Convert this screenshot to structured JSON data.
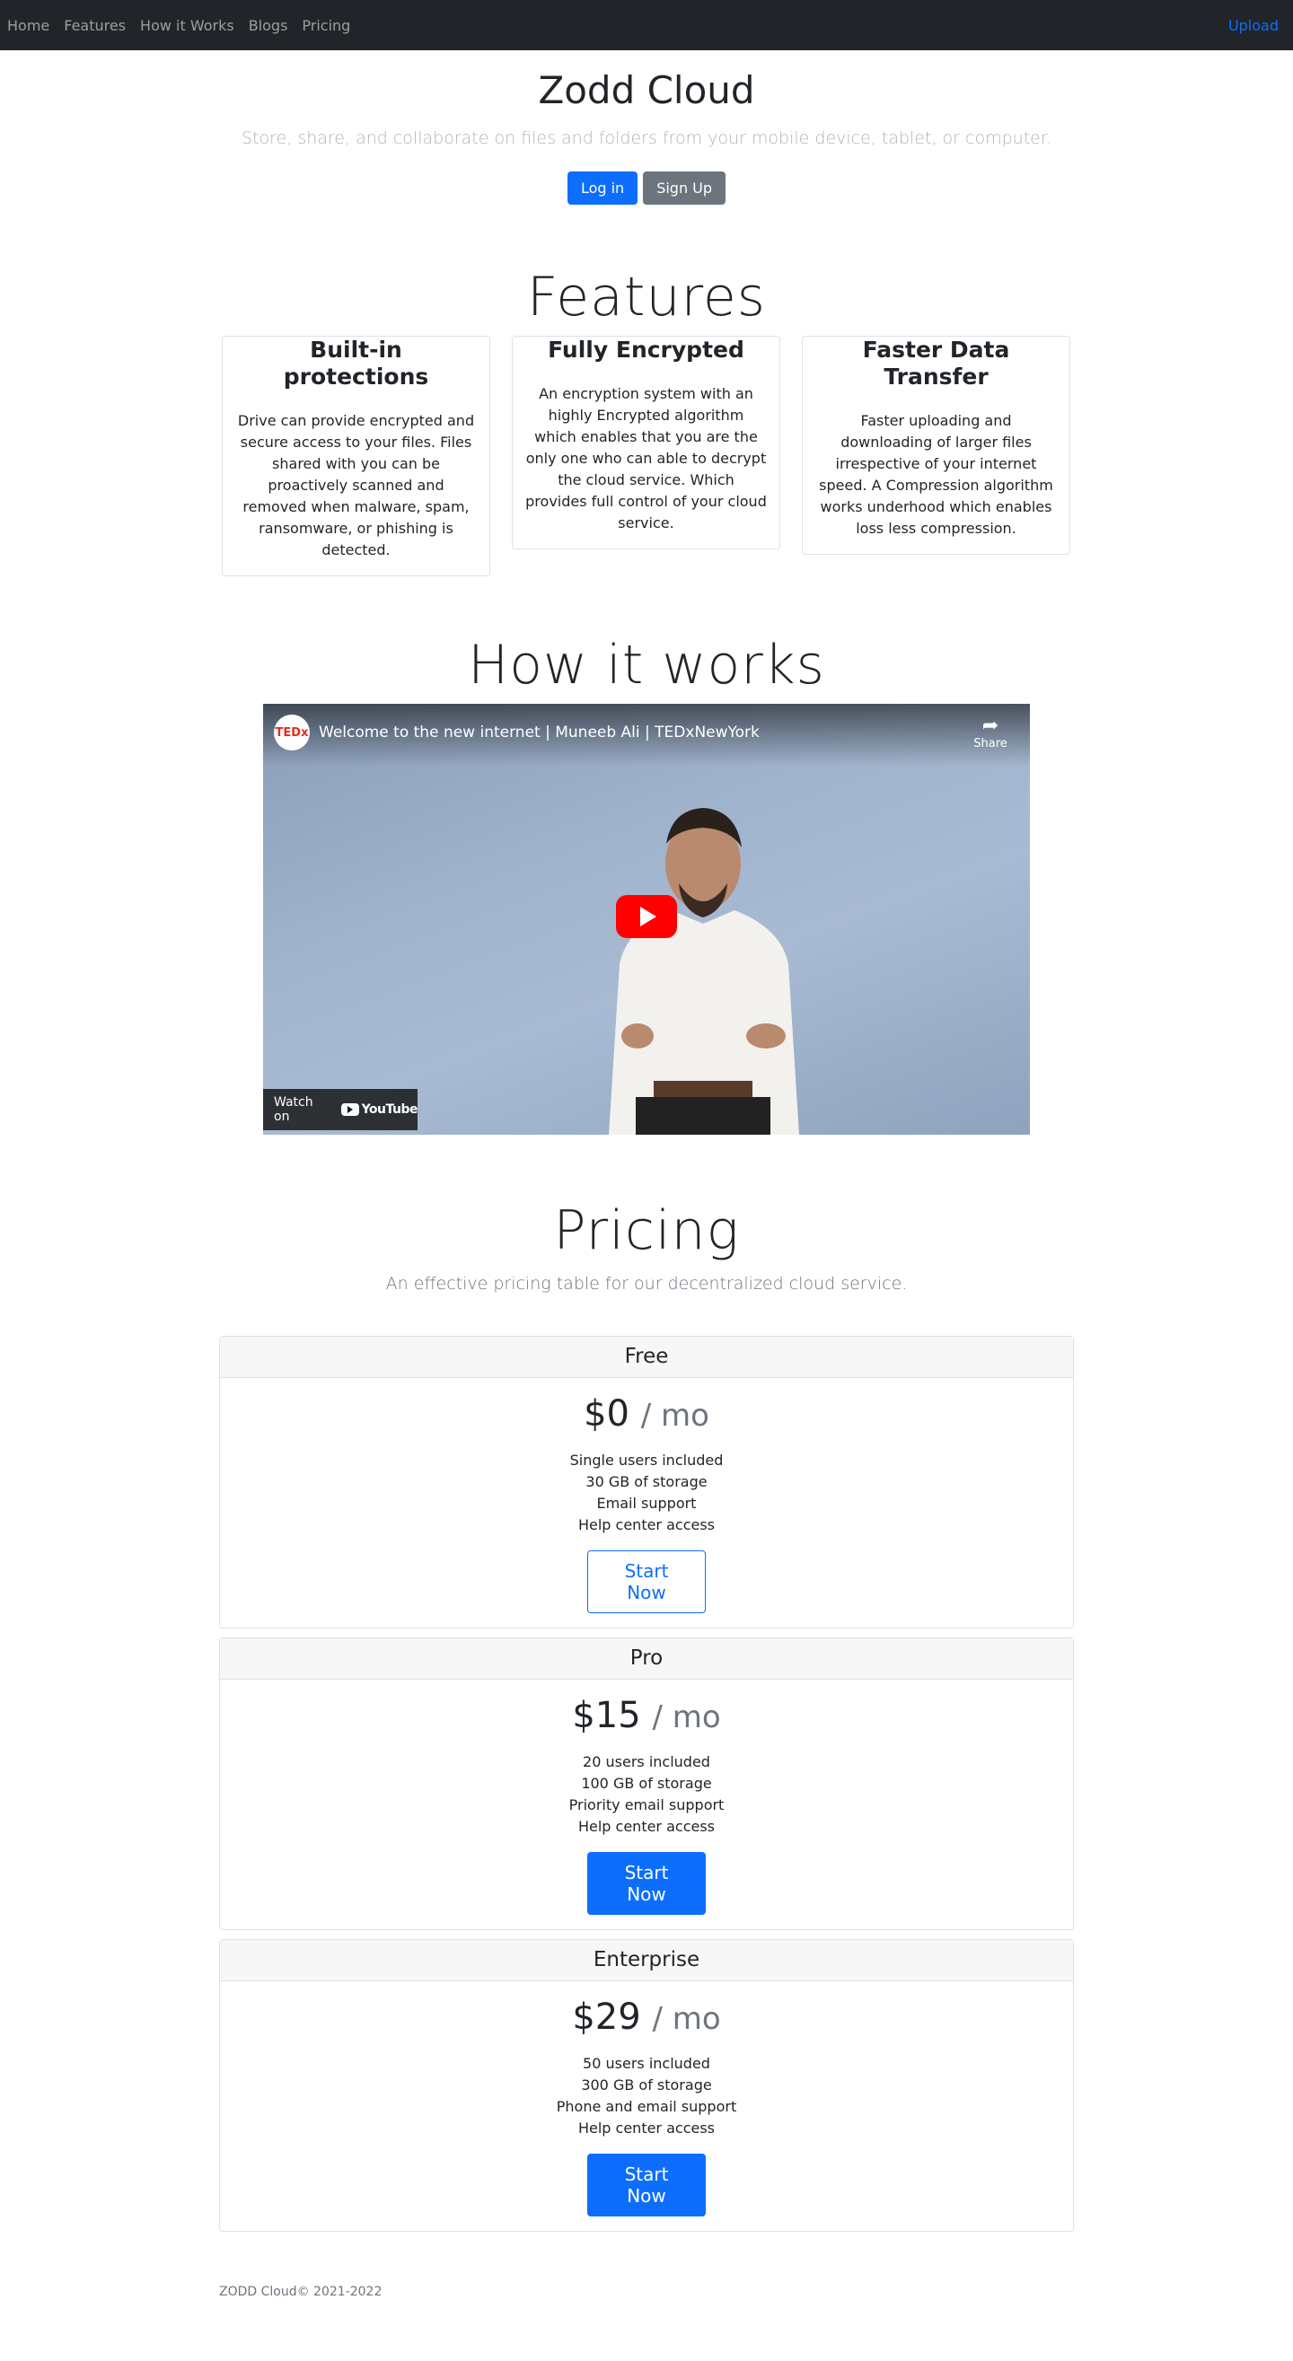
{
  "nav": {
    "links": [
      "Home",
      "Features",
      "How it Works",
      "Blogs",
      "Pricing"
    ],
    "upload": "Upload"
  },
  "hero": {
    "title": "Zodd Cloud",
    "subtitle": "Store, share, and collaborate on files and folders from your mobile device, tablet, or computer.",
    "login": "Log in",
    "signup": "Sign Up"
  },
  "features": {
    "title": "Features",
    "cards": [
      {
        "title": "Built-in protections",
        "text": "Drive can provide encrypted and secure access to your files. Files shared with you can be proactively scanned and removed when malware, spam, ransomware, or phishing is detected."
      },
      {
        "title": "Fully Encrypted",
        "text": "An encryption system with an highly Encrypted algorithm which enables that you are the only one who can able to decrypt the cloud service. Which provides full control of your cloud service."
      },
      {
        "title": "Faster Data Transfer",
        "text": "Faster uploading and downloading of larger files irrespective of your internet speed. A Compression algorithm works underhood which enables loss less compression."
      }
    ]
  },
  "how": {
    "title": "How it works",
    "video_title": "Welcome to the new internet | Muneeb Ali | TEDxNewYork",
    "ted_logo": "TEDx",
    "share": "Share",
    "watch_on": "Watch on",
    "youtube": "YouTube"
  },
  "pricing": {
    "title": "Pricing",
    "subtitle": "An effective pricing table for our decentralized cloud service.",
    "per": "/ mo",
    "plans": [
      {
        "name": "Free",
        "price": "$0",
        "features": [
          "Single users included",
          "30 GB of storage",
          "Email support",
          "Help center access"
        ],
        "button": "Start Now"
      },
      {
        "name": "Pro",
        "price": "$15",
        "features": [
          "20 users included",
          "100 GB of storage",
          "Priority email support",
          "Help center access"
        ],
        "button": "Start Now"
      },
      {
        "name": "Enterprise",
        "price": "$29",
        "features": [
          "50 users included",
          "300 GB of storage",
          "Phone and email support",
          "Help center access"
        ],
        "button": "Start Now"
      }
    ]
  },
  "footer": {
    "text": "ZODD Cloud© 2021-2022"
  },
  "colors": {
    "navbar": "#212529",
    "primary": "#0d6efd",
    "secondary": "#6c757d",
    "youtube_red": "#ff0000"
  }
}
